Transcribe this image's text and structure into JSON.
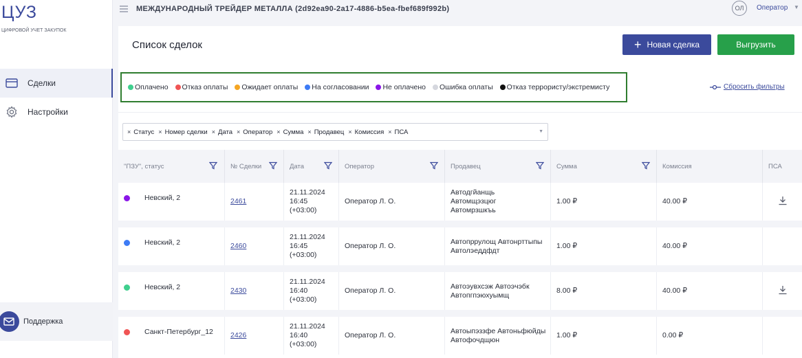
{
  "sidebar": {
    "logo_title": "ЦУЗ",
    "logo_subtitle": "цифровой учет закупок",
    "items": [
      {
        "label": "Сделки",
        "icon": "card-icon",
        "active": true
      },
      {
        "label": "Настройки",
        "icon": "gear-icon",
        "active": false
      }
    ],
    "support_label": "Поддержка"
  },
  "topbar": {
    "org_title": "МЕЖДУНАРОДНЫЙ ТРЕЙДЕР МЕТАЛЛА (2d92ea90-2a17-4886-b5ea-fbef689f992b)",
    "user_initials": "ОЛ",
    "user_role": "Оператор"
  },
  "page": {
    "title": "Список сделок",
    "new_deal_label": "Новая сделка",
    "export_label": "Выгрузить",
    "reset_filters_label": "Сбросить фильтры"
  },
  "legend": [
    {
      "label": "Оплачено",
      "color": "#3fcf8e"
    },
    {
      "label": "Отказ оплаты",
      "color": "#f05454"
    },
    {
      "label": "Ожидает оплаты",
      "color": "#f5a623"
    },
    {
      "label": "На согласовании",
      "color": "#3d7bf5"
    },
    {
      "label": "Не оплачено",
      "color": "#8a16e8"
    },
    {
      "label": "Ошибка оплаты",
      "color": "#d5d7de"
    },
    {
      "label": "Отказ террористу/экстремисту",
      "color": "#111111"
    }
  ],
  "column_chips": [
    "Статус",
    "Номер сделки",
    "Дата",
    "Оператор",
    "Сумма",
    "Продавец",
    "Комиссия",
    "ПСА"
  ],
  "table": {
    "headers": [
      "\"ПЗУ\", статус",
      "№ Сделки",
      "Дата",
      "Оператор",
      "Продавец",
      "Сумма",
      "Комиссия",
      "ПСА"
    ],
    "rows": [
      {
        "status_color": "#8a16e8",
        "pzu": "Невский, 2",
        "deal": "2461",
        "date": "21.11.2024",
        "time": "16:45",
        "tz": "(+03:00)",
        "operator": "Оператор Л. О.",
        "seller_1": "Автодгйанщь",
        "seller_2": "Автомщэзцюг",
        "seller_3": "Автомрзшкъь",
        "sum": "1.00 ₽",
        "commission": "40.00 ₽",
        "psa_download": true
      },
      {
        "status_color": "#3d7bf5",
        "pzu": "Невский, 2",
        "deal": "2460",
        "date": "21.11.2024",
        "time": "16:45",
        "tz": "(+03:00)",
        "operator": "Оператор Л. О.",
        "seller_1": "Автопррулощ Автонрттыпы",
        "seller_2": "Автолэеддфдт",
        "seller_3": "",
        "sum": "1.00 ₽",
        "commission": "40.00 ₽",
        "psa_download": false
      },
      {
        "status_color": "#3fcf8e",
        "pzu": "Невский, 2",
        "deal": "2430",
        "date": "21.11.2024",
        "time": "16:40",
        "tz": "(+03:00)",
        "operator": "Оператор Л. О.",
        "seller_1": "Автоэувхсэж Автоэчэбк",
        "seller_2": "Автопгпэюхуымщ",
        "seller_3": "",
        "sum": "8.00 ₽",
        "commission": "40.00 ₽",
        "psa_download": true
      },
      {
        "status_color": "#f05454",
        "pzu": "Санкт-Петербург_12",
        "deal": "2426",
        "date": "21.11.2024",
        "time": "16:40",
        "tz": "(+03:00)",
        "operator": "Оператор Л. О.",
        "seller_1": "Автоыпэззфе Автоньфюйды",
        "seller_2": "Автофочдщюн",
        "seller_3": "",
        "sum": "1.00 ₽",
        "commission": "0.00 ₽",
        "psa_download": false
      }
    ]
  }
}
